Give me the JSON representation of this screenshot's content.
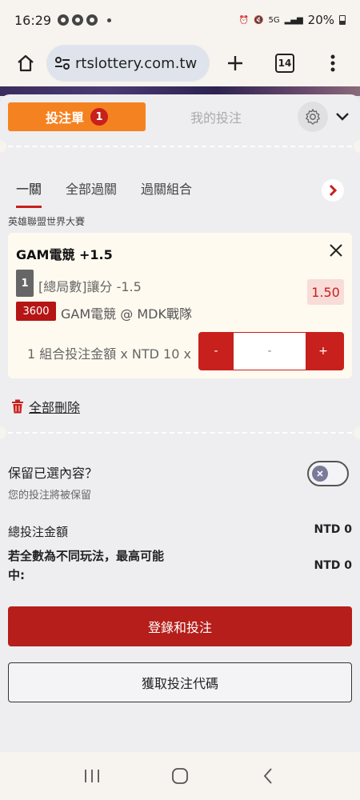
{
  "status": {
    "time": "16:29",
    "battery": "20%",
    "network": "5G"
  },
  "browser": {
    "url": "rtslottery.com.tw",
    "tab_count": "14"
  },
  "sheet": {
    "tabs": {
      "betslip": "投注單",
      "betslip_count": "1",
      "my_bets": "我的投注"
    },
    "bet_types": [
      "一關",
      "全部過關",
      "過關組合"
    ],
    "league": "英雄聯盟世界大賽",
    "bet": {
      "selection": "GAM電競 +1.5",
      "num": "1",
      "market": "[總局數]讓分 -1.5",
      "odds": "1.50",
      "code": "3600",
      "match": "GAM電競 @ MDK戰隊",
      "stake_label": "1 組合投注金額 x NTD 10 x",
      "stepper_minus": "-",
      "stepper_value": "-",
      "stepper_plus": "+"
    },
    "delete_all": "全部刪除",
    "keep": {
      "title": "保留已選內容？",
      "subtitle": "您的投注將被保留"
    },
    "totals": {
      "total_label": "總投注金額",
      "total_value": "NTD 0",
      "payout_label": "若全數為不同玩法，最高可能中:",
      "payout_value": "NTD 0"
    },
    "buttons": {
      "login_bet": "登錄和投注",
      "get_code": "獲取投注代碼"
    }
  },
  "colors": {
    "accent_orange": "#f58220",
    "accent_red": "#c8201c"
  }
}
